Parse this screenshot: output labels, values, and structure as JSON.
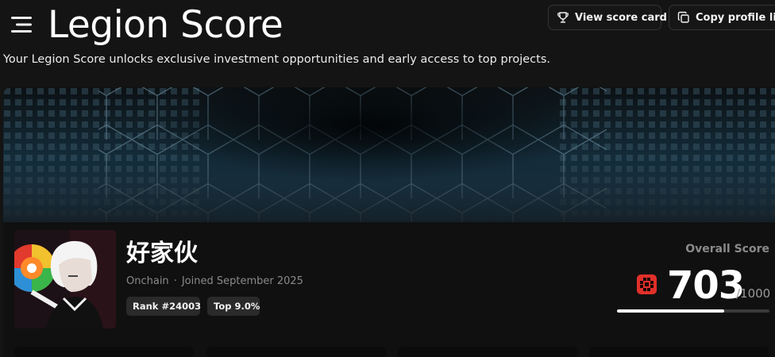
{
  "header": {
    "title": "Legion Score",
    "subtitle": "Your Legion Score unlocks exclusive investment opportunities and early access to top projects.",
    "menu_icon": "hamburger-menu-icon",
    "buttons": [
      {
        "label": "View score card",
        "icon": "trophy-icon"
      },
      {
        "label": "Copy profile link",
        "icon": "copy-icon"
      }
    ]
  },
  "profile": {
    "name": "好家伙",
    "source": "Onchain",
    "separator": "·",
    "joined": "Joined September 2025",
    "rank_badge": "Rank #24003",
    "top_badge": "Top 9.0%"
  },
  "score": {
    "label": "Overall Score",
    "value": "703",
    "max": "/1000",
    "progress_fraction": 0.703
  },
  "colors": {
    "background": "#141414",
    "accent_red": "#e0302a",
    "banner_blue": "#1f4a66"
  }
}
